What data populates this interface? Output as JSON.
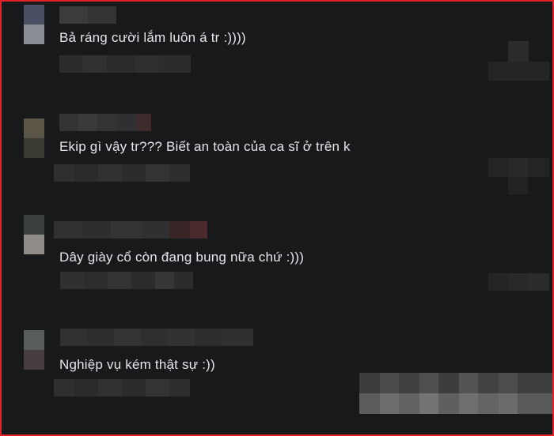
{
  "comments": [
    {
      "text": "Bả ráng cười lắm luôn á tr :))))"
    },
    {
      "text": "Ekip gì vậy tr??? Biết an toàn của ca sĩ ở trên k"
    },
    {
      "text": "Dây giày cổ còn đang bung nữa chứ :)))"
    },
    {
      "text": "Nghiệp vụ kém thật sự :))"
    }
  ],
  "colors": {
    "background": "#18191a",
    "text": "#e4e6eb",
    "border": "#e0242a"
  }
}
